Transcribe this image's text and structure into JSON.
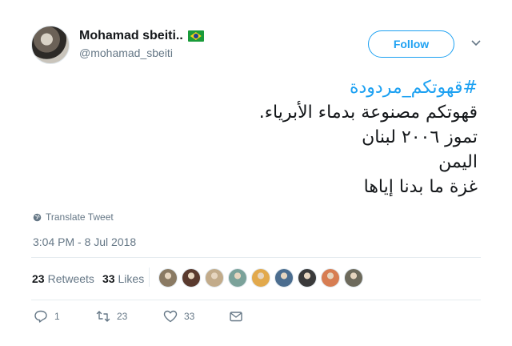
{
  "author": {
    "display_name": "Mohamad sbeiti..",
    "handle": "@mohamad_sbeiti",
    "flag_icon": "brazil-flag-icon"
  },
  "follow_label": "Follow",
  "tweet": {
    "hashtag": "#قهوتكم_مردودة",
    "lines": [
      "قهوتكم مصنوعة بدماء الأبرياء.",
      "تموز ٢٠٠٦ لبنان",
      "اليمن",
      "غزة ما بدنا إياها"
    ]
  },
  "translate_label": "Translate Tweet",
  "timestamp": "3:04 PM - 8 Jul 2018",
  "stats": {
    "retweets_count": "23",
    "retweets_label": "Retweets",
    "likes_count": "33",
    "likes_label": "Likes"
  },
  "likers": [
    {
      "color": "#8a7a63"
    },
    {
      "color": "#5a3a2e"
    },
    {
      "color": "#c2ab8a"
    },
    {
      "color": "#7ba29a"
    },
    {
      "color": "#e2a94c"
    },
    {
      "color": "#4b6d8f"
    },
    {
      "color": "#3a3a3a"
    },
    {
      "color": "#d77d52"
    },
    {
      "color": "#6d6a5c"
    }
  ],
  "actions": {
    "reply_count": "1",
    "retweet_count": "23",
    "like_count": "33"
  },
  "colors": {
    "accent": "#1da1f2",
    "muted": "#657786",
    "text": "#14171a"
  }
}
